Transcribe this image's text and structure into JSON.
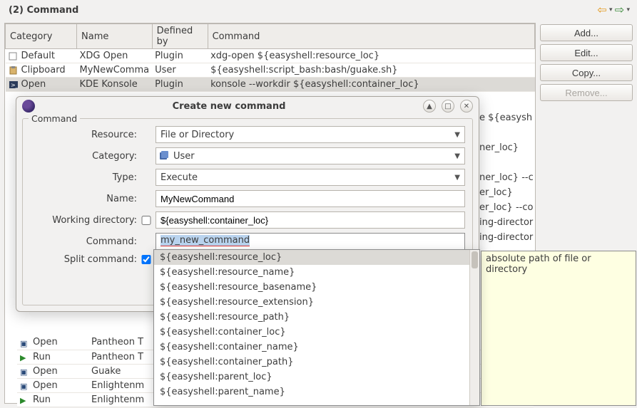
{
  "header": {
    "title": "(2) Command"
  },
  "table": {
    "cols": [
      "Category",
      "Name",
      "Defined by",
      "Command"
    ],
    "rows": [
      {
        "category": "Default",
        "name": "XDG Open",
        "defined": "Plugin",
        "command": "xdg-open ${easyshell:resource_loc}",
        "icon": "file"
      },
      {
        "category": "Clipboard",
        "name": "MyNewComma",
        "defined": "User",
        "command": "${easyshell:script_bash:bash/guake.sh}",
        "icon": "clip"
      },
      {
        "category": "Open",
        "name": "KDE Konsole",
        "defined": "Plugin",
        "command": "konsole --workdir ${easyshell:container_loc}",
        "icon": "cmd",
        "selected": true
      }
    ],
    "bg_rows": [
      {
        "icon": "open",
        "category": "Open",
        "name": "Pantheon T"
      },
      {
        "icon": "run",
        "category": "Run",
        "name": "Pantheon T"
      },
      {
        "icon": "open",
        "category": "Open",
        "name": "Guake"
      },
      {
        "icon": "open",
        "category": "Open",
        "name": "Enlightenm"
      },
      {
        "icon": "run",
        "category": "Run",
        "name": "Enlightenm"
      }
    ]
  },
  "buttons": {
    "add": "Add...",
    "edit": "Edit...",
    "copy": "Copy...",
    "remove": "Remove..."
  },
  "dialog": {
    "title": "Create new command",
    "group": "Command",
    "labels": {
      "resource": "Resource:",
      "category": "Category:",
      "type": "Type:",
      "name": "Name:",
      "workdir": "Working directory:",
      "command": "Command:",
      "split": "Split command:"
    },
    "resource_value": "File or Directory",
    "category_value": "User",
    "type_value": "Execute",
    "name_value": "MyNewCommand",
    "workdir_value": "${easyshell:container_loc}",
    "command_value": "my_new_command"
  },
  "autocomplete": {
    "items": [
      "${easyshell:resource_loc}",
      "${easyshell:resource_name}",
      "${easyshell:resource_basename}",
      "${easyshell:resource_extension}",
      "${easyshell:resource_path}",
      "${easyshell:container_loc}",
      "${easyshell:container_name}",
      "${easyshell:container_path}",
      "${easyshell:parent_loc}",
      "${easyshell:parent_name}"
    ],
    "selected_index": 0
  },
  "tooltip": "absolute path of file or directory",
  "peek_text": {
    "p1": "e ${easysh",
    "p2": "ner_loc}",
    "p3": "ner_loc} --c",
    "p4": "er_loc}",
    "p5": "er_loc} --co",
    "p6": "ing-director",
    "p7": "ing-director"
  }
}
